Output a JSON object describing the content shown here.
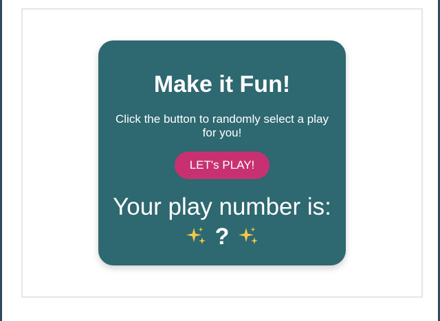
{
  "card": {
    "title": "Make it Fun!",
    "subtitle": "Click the button to randomly select a play for you!",
    "button_label": "LET's PLAY!",
    "result_label": "Your play number is:",
    "result_value": "?"
  },
  "icons": {
    "left": "sparkles-icon",
    "right": "sparkles-icon"
  },
  "colors": {
    "card_background": "#2e6870",
    "button_background": "#c83171",
    "text": "#ffffff",
    "sparkle": "#f7c948",
    "frame_border": "#2f4a5c"
  }
}
